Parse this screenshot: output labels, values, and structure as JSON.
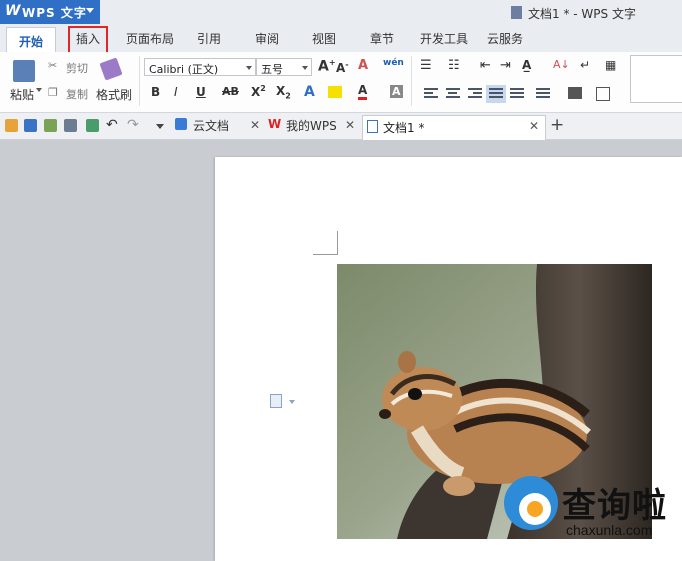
{
  "app": {
    "name": "WPS 文字",
    "window_title": "文档1 * - WPS 文字"
  },
  "ribbon_tabs": [
    "开始",
    "插入",
    "页面布局",
    "引用",
    "审阅",
    "视图",
    "章节",
    "开发工具",
    "云服务"
  ],
  "clipboard": {
    "paste": "粘贴",
    "cut": "剪切",
    "copy": "复制",
    "format_painter": "格式刷"
  },
  "font": {
    "family": "Calibri (正文)",
    "size": "五号"
  },
  "doc_tabs": [
    {
      "label": "云文档",
      "icon": "cloud-icon"
    },
    {
      "label": "我的WPS",
      "icon": "wps-logo-icon"
    },
    {
      "label": "文档1 *",
      "icon": "document-icon"
    }
  ],
  "watermark": {
    "cn": "查询啦",
    "en": "chaxunla.com"
  },
  "colors": {
    "app_blue": "#2f6fc6",
    "highlight_red": "#e0262b",
    "font_red": "#e02020",
    "highlight_yellow": "#f5e000"
  }
}
